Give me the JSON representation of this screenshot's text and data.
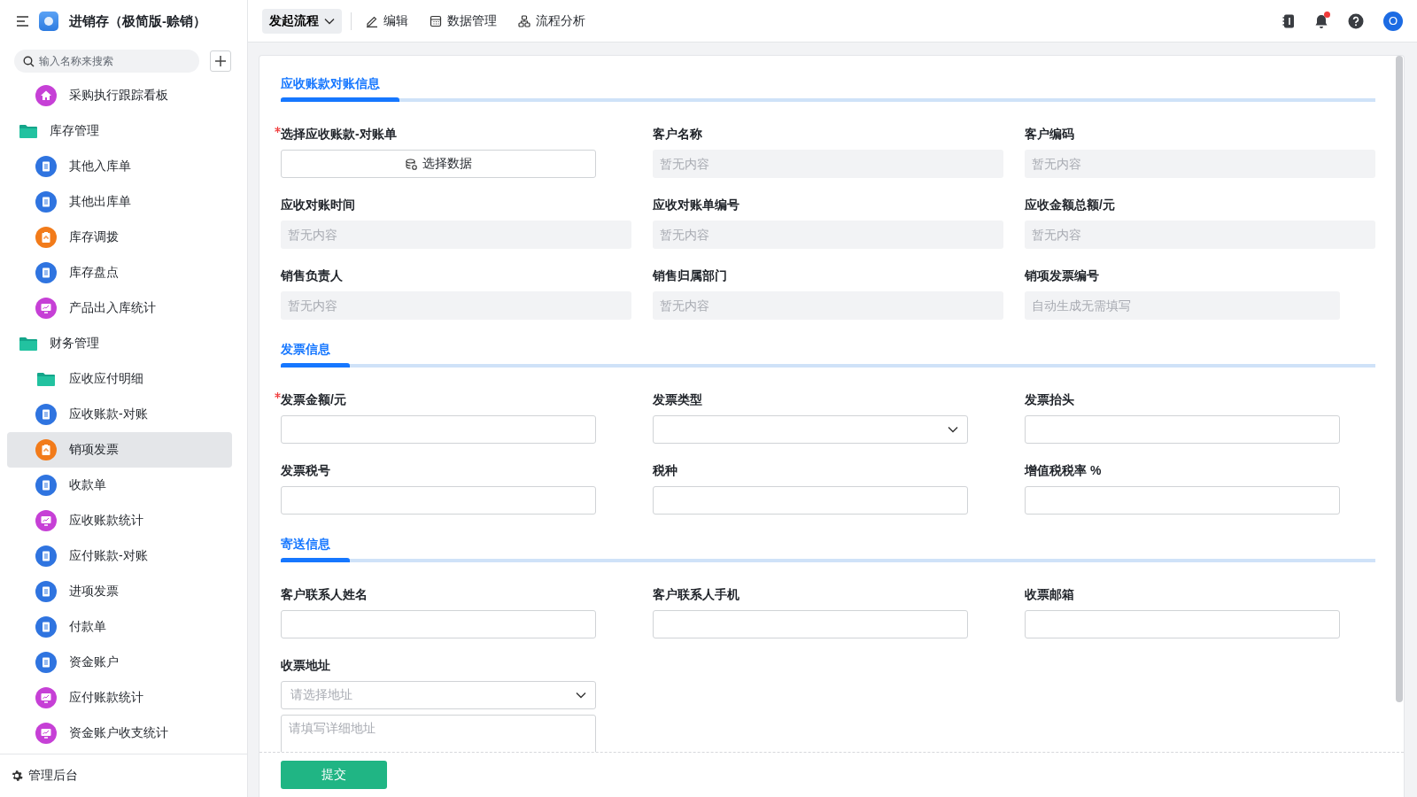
{
  "app": {
    "title": "进销存（极简版-赊销）"
  },
  "sidebar": {
    "search": {
      "placeholder": "输入名称来搜索"
    },
    "items": [
      {
        "kind": "home",
        "label": "采购执行跟踪看板",
        "selected": false
      },
      {
        "kind": "folder",
        "label": "库存管理",
        "selected": false,
        "children": [
          {
            "kind": "doc",
            "label": "其他入库单",
            "selected": false
          },
          {
            "kind": "doc",
            "label": "其他出库单",
            "selected": false
          },
          {
            "kind": "flow",
            "label": "库存调拨",
            "selected": false
          },
          {
            "kind": "doc",
            "label": "库存盘点",
            "selected": false
          },
          {
            "kind": "chart",
            "label": "产品出入库统计",
            "selected": false
          }
        ]
      },
      {
        "kind": "folder",
        "label": "财务管理",
        "selected": false,
        "children": [
          {
            "kind": "folder",
            "label": "应收应付明细",
            "selected": false
          },
          {
            "kind": "doc",
            "label": "应收账款-对账",
            "selected": false
          },
          {
            "kind": "flow",
            "label": "销项发票",
            "selected": true
          },
          {
            "kind": "doc",
            "label": "收款单",
            "selected": false
          },
          {
            "kind": "chart",
            "label": "应收账款统计",
            "selected": false
          },
          {
            "kind": "doc",
            "label": "应付账款-对账",
            "selected": false
          },
          {
            "kind": "doc",
            "label": "进项发票",
            "selected": false
          },
          {
            "kind": "doc",
            "label": "付款单",
            "selected": false
          },
          {
            "kind": "doc",
            "label": "资金账户",
            "selected": false
          },
          {
            "kind": "chart",
            "label": "应付账款统计",
            "selected": false
          },
          {
            "kind": "chart",
            "label": "资金账户收支统计",
            "selected": false
          }
        ]
      }
    ],
    "footer": "管理后台"
  },
  "toolbar": {
    "start_button": "发起流程",
    "actions": [
      {
        "kind": "edit",
        "label": "编辑"
      },
      {
        "kind": "grid",
        "label": "数据管理"
      },
      {
        "kind": "flow",
        "label": "流程分析"
      }
    ],
    "has_notification": true,
    "avatar": "O"
  },
  "form": {
    "sections": [
      {
        "title": "应收账款对账信息",
        "fields": [
          {
            "kind": "button",
            "label": "选择应收账款-对账单",
            "required": true,
            "value": "选择数据"
          },
          {
            "kind": "readonly",
            "label": "客户名称",
            "required": false,
            "placeholder": "暂无内容"
          },
          {
            "kind": "readonly",
            "label": "客户编码",
            "required": false,
            "placeholder": "暂无内容"
          },
          {
            "kind": "readonly",
            "label": "应收对账时间",
            "required": false,
            "placeholder": "暂无内容"
          },
          {
            "kind": "readonly",
            "label": "应收对账单编号",
            "required": false,
            "placeholder": "暂无内容"
          },
          {
            "kind": "readonly",
            "label": "应收金额总额/元",
            "required": false,
            "placeholder": "暂无内容"
          },
          {
            "kind": "readonly",
            "label": "销售负责人",
            "required": false,
            "placeholder": "暂无内容"
          },
          {
            "kind": "readonly",
            "label": "销售归属部门",
            "required": false,
            "placeholder": "暂无内容"
          },
          {
            "kind": "auto",
            "label": "销项发票编号",
            "required": false,
            "placeholder": "自动生成无需填写"
          }
        ]
      },
      {
        "title": "发票信息",
        "fields": [
          {
            "kind": "input",
            "label": "发票金额/元",
            "required": true
          },
          {
            "kind": "select",
            "label": "发票类型",
            "required": false
          },
          {
            "kind": "input",
            "label": "发票抬头",
            "required": false
          },
          {
            "kind": "input",
            "label": "发票税号",
            "required": false
          },
          {
            "kind": "input",
            "label": "税种",
            "required": false
          },
          {
            "kind": "input",
            "label": "增值税税率 %",
            "required": false
          }
        ]
      },
      {
        "title": "寄送信息",
        "fields": [
          {
            "kind": "input",
            "label": "客户联系人姓名",
            "required": false
          },
          {
            "kind": "input",
            "label": "客户联系人手机",
            "required": false
          },
          {
            "kind": "input",
            "label": "收票邮箱",
            "required": false
          },
          {
            "kind": "address",
            "label": "收票地址",
            "required": false,
            "placeholder": "请选择地址",
            "detail_placeholder": "请填写详细地址"
          }
        ]
      }
    ],
    "submit": "提交"
  }
}
